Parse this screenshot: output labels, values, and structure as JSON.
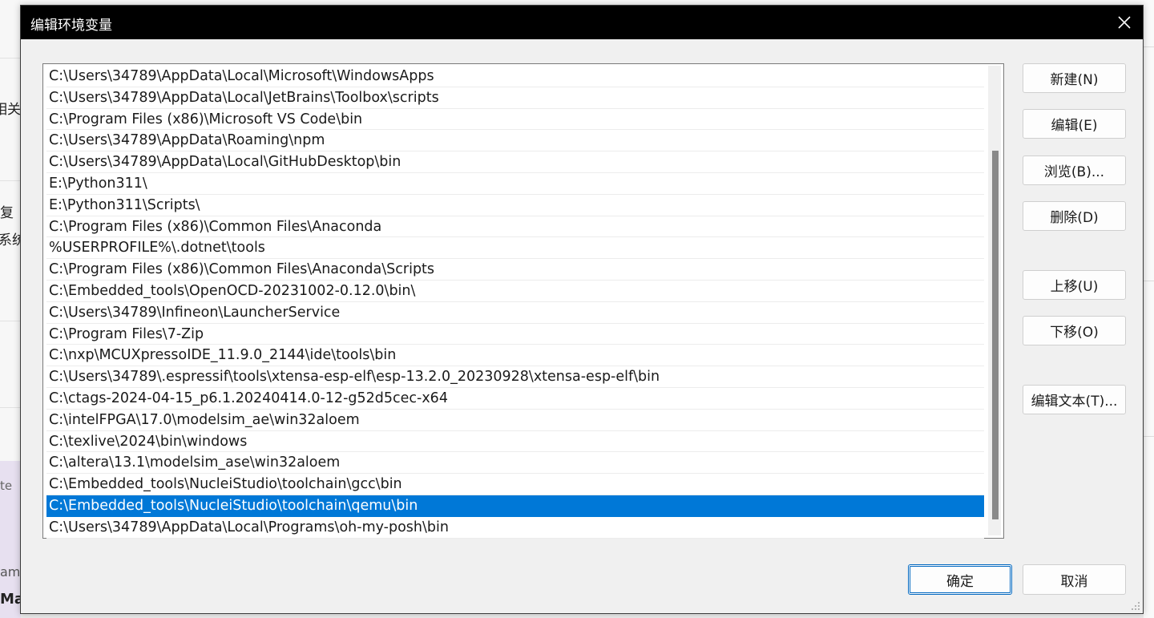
{
  "dialog": {
    "title": "编辑环境变量",
    "close_label": "✕"
  },
  "path_list": {
    "selected_index": 20,
    "items": [
      "C:\\Users\\34789\\AppData\\Local\\Microsoft\\WindowsApps",
      "C:\\Users\\34789\\AppData\\Local\\JetBrains\\Toolbox\\scripts",
      "C:\\Program Files (x86)\\Microsoft VS Code\\bin",
      "C:\\Users\\34789\\AppData\\Roaming\\npm",
      "C:\\Users\\34789\\AppData\\Local\\GitHubDesktop\\bin",
      "E:\\Python311\\",
      "E:\\Python311\\Scripts\\",
      "C:\\Program Files (x86)\\Common Files\\Anaconda",
      "%USERPROFILE%\\.dotnet\\tools",
      "C:\\Program Files (x86)\\Common Files\\Anaconda\\Scripts",
      "C:\\Embedded_tools\\OpenOCD-20231002-0.12.0\\bin\\",
      "C:\\Users\\34789\\Infineon\\LauncherService",
      "C:\\Program Files\\7-Zip",
      "C:\\nxp\\MCUXpressoIDE_11.9.0_2144\\ide\\tools\\bin",
      "C:\\Users\\34789\\.espressif\\tools\\xtensa-esp-elf\\esp-13.2.0_20230928\\xtensa-esp-elf\\bin",
      "C:\\ctags-2024-04-15_p6.1.20240414.0-12-g52d5cec-x64",
      "C:\\intelFPGA\\17.0\\modelsim_ae\\win32aloem",
      "C:\\texlive\\2024\\bin\\windows",
      "C:\\altera\\13.1\\modelsim_ase\\win32aloem",
      "C:\\Embedded_tools\\NucleiStudio\\toolchain\\gcc\\bin",
      "C:\\Embedded_tools\\NucleiStudio\\toolchain\\qemu\\bin",
      "C:\\Users\\34789\\AppData\\Local\\Programs\\oh-my-posh\\bin"
    ]
  },
  "buttons": {
    "new": "新建(N)",
    "edit": "编辑(E)",
    "browse": "浏览(B)...",
    "delete": "删除(D)",
    "move_up": "上移(U)",
    "move_down": "下移(O)",
    "edit_text": "编辑文本(T)...",
    "ok": "确定",
    "cancel": "取消"
  },
  "background_fragments": {
    "frag1": "相关",
    "frag2": "复",
    "frag3": "系统",
    "frag4": "te",
    "frag5": "am",
    "frag6": "Ma"
  },
  "colors": {
    "selection": "#0078d7",
    "titlebar": "#000000",
    "primary_border": "#0067c0"
  }
}
